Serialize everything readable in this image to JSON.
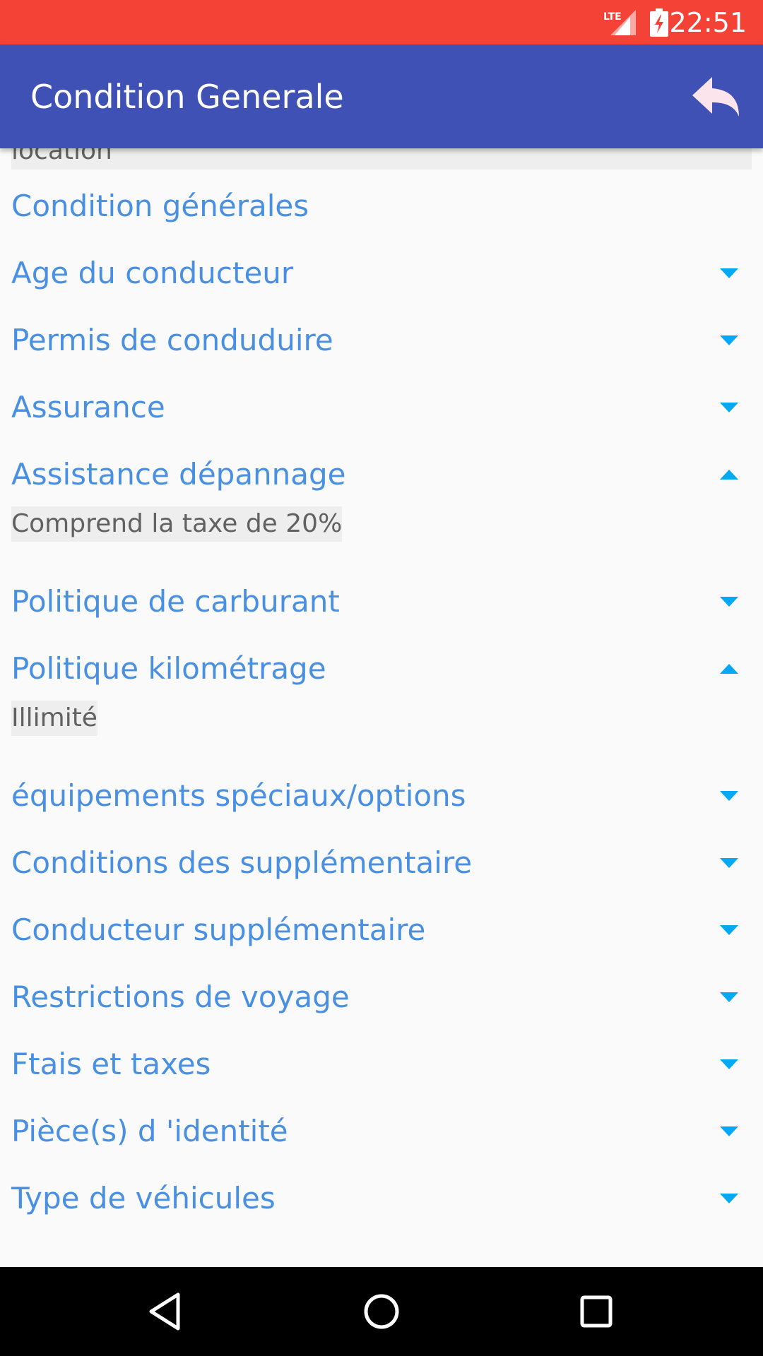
{
  "status_bar": {
    "network_label": "LTE",
    "time": "22:51",
    "icons": [
      "lte-signal-icon",
      "battery-charging-icon"
    ]
  },
  "app_bar": {
    "title": "Condition Generale",
    "back_icon": "reply-arrow-icon"
  },
  "partial_text": "location",
  "section_header": "Condition générales",
  "items": [
    {
      "label": "Age du conducteur",
      "expanded": false
    },
    {
      "label": "Permis de conduduire",
      "expanded": false
    },
    {
      "label": "Assurance",
      "expanded": false
    },
    {
      "label": "Assistance dépannage",
      "expanded": true,
      "detail": "Comprend la taxe de 20%"
    },
    {
      "label": "Politique de carburant",
      "expanded": false
    },
    {
      "label": "Politique kilométrage",
      "expanded": true,
      "detail": "Illimité"
    },
    {
      "label": "équipements spéciaux/options",
      "expanded": false
    },
    {
      "label": "Conditions des supplémentaire",
      "expanded": false
    },
    {
      "label": "Conducteur supplémentaire",
      "expanded": false
    },
    {
      "label": "Restrictions de voyage",
      "expanded": false
    },
    {
      "label": "Ftais  et taxes",
      "expanded": false
    },
    {
      "label": "Pièce(s) d 'identité",
      "expanded": false
    },
    {
      "label": "Type de véhicules",
      "expanded": false
    }
  ],
  "nav_bar": {
    "icons": [
      "back-triangle-icon",
      "home-circle-icon",
      "recents-square-icon"
    ]
  },
  "colors": {
    "status_bar": "#f44336",
    "app_bar": "#3f51b5",
    "item_text": "#4a90e2",
    "arrow": "#03a9f4",
    "detail_bg": "#eeeeee",
    "detail_text": "#616161"
  }
}
